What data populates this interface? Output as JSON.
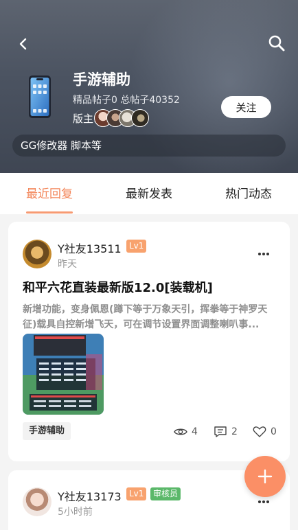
{
  "header": {
    "title": "手游辅助",
    "stats": "精品帖子0 总帖子40352",
    "moderator_label": "版主:",
    "follow_label": "关注",
    "description": "GG修改器 脚本等",
    "icons": [
      "back-icon",
      "search-icon",
      "phone-icon"
    ]
  },
  "tabs": [
    {
      "label": "最近回复",
      "active": true
    },
    {
      "label": "最新发表",
      "active": false
    },
    {
      "label": "热门动态",
      "active": false
    }
  ],
  "posts": [
    {
      "username": "Y社友13511",
      "level": "Lv1",
      "time": "昨天",
      "title": "和平六花直装最新版12.0[装载机]",
      "excerpt": "新增功能，变身佩恩(蹲下等于万象天引，挥拳等于神罗天征)载具自控新增飞天，可在调节设置界面调整喇叭事...",
      "tag": "手游辅助",
      "views": "4",
      "comments": "2",
      "likes": "0"
    },
    {
      "username": "Y社友13173",
      "level": "Lv1",
      "role": "审核员",
      "time": "5小时前"
    }
  ],
  "colors": {
    "accent": "#f3865a",
    "fab": "#fb8f66",
    "level_badge": "#f8a26e",
    "reviewer_badge": "#5bb86a"
  }
}
